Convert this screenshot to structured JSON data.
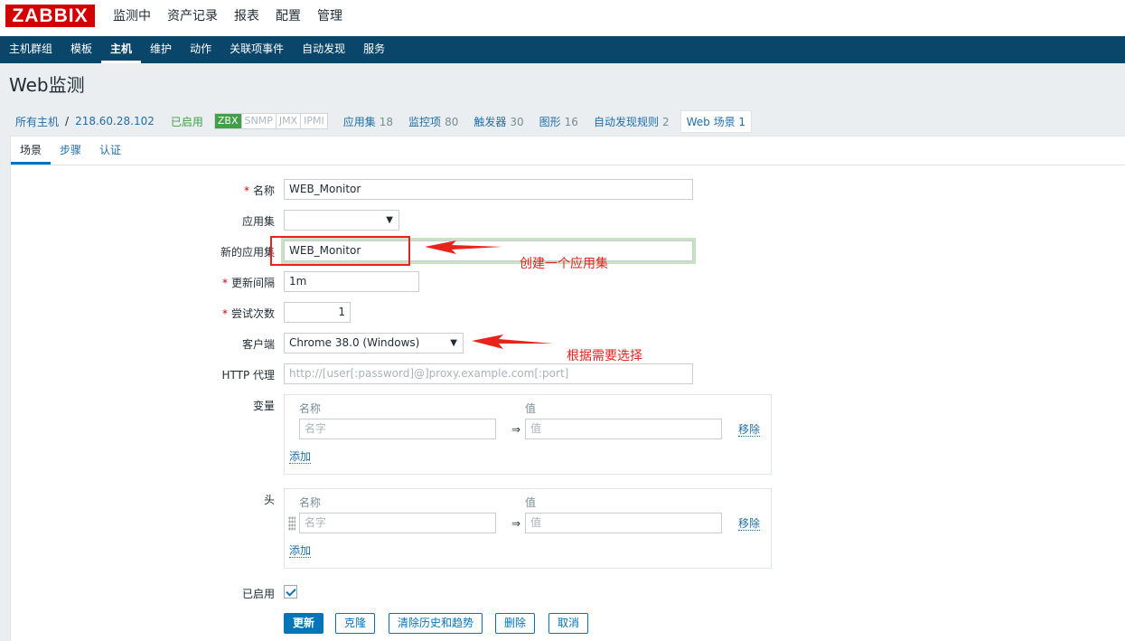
{
  "logo": "ZABBIX",
  "main_menu": [
    "监测中",
    "资产记录",
    "报表",
    "配置",
    "管理"
  ],
  "sub_menu": [
    "主机群组",
    "模板",
    "主机",
    "维护",
    "动作",
    "关联项事件",
    "自动发现",
    "服务"
  ],
  "page_title": "Web监测",
  "breadcrumb": {
    "all_hosts": "所有主机",
    "separator": "/",
    "host": "218.60.28.102",
    "status": "已启用",
    "availability": [
      "ZBX",
      "SNMP",
      "JMX",
      "IPMI"
    ],
    "items": [
      {
        "label": "应用集",
        "count": "18"
      },
      {
        "label": "监控项",
        "count": "80"
      },
      {
        "label": "触发器",
        "count": "30"
      },
      {
        "label": "图形",
        "count": "16"
      },
      {
        "label": "自动发现规则",
        "count": "2"
      }
    ],
    "current": {
      "label": "Web 场景",
      "count": "1"
    }
  },
  "tabs": [
    "场景",
    "步骤",
    "认证"
  ],
  "form": {
    "name_label": "名称",
    "name_value": "WEB_Monitor",
    "app_label": "应用集",
    "app_value": "",
    "new_app_label": "新的应用集",
    "new_app_value": "WEB_Monitor",
    "interval_label": "更新间隔",
    "interval_value": "1m",
    "attempts_label": "尝试次数",
    "attempts_value": "1",
    "agent_label": "客户端",
    "agent_value": "Chrome 38.0 (Windows)",
    "proxy_label": "HTTP 代理",
    "proxy_placeholder": "http://[user[:password]@]proxy.example.com[:port]",
    "variables_label": "变量",
    "headers_label": "头",
    "col_name": "名称",
    "col_value": "值",
    "name_placeholder": "名字",
    "value_placeholder": "值",
    "arrow": "⇒",
    "remove": "移除",
    "add": "添加",
    "enabled_label": "已启用"
  },
  "buttons": [
    "更新",
    "克隆",
    "清除历史和趋势",
    "删除",
    "取消"
  ],
  "annotations": {
    "create_app": "创建一个应用集",
    "choose": "根据需要选择"
  },
  "colors": {
    "brand": "#d40000",
    "header": "#0a466a",
    "accent": "#0275b8",
    "annotation": "#e8231c",
    "enabled": "#429e47"
  }
}
